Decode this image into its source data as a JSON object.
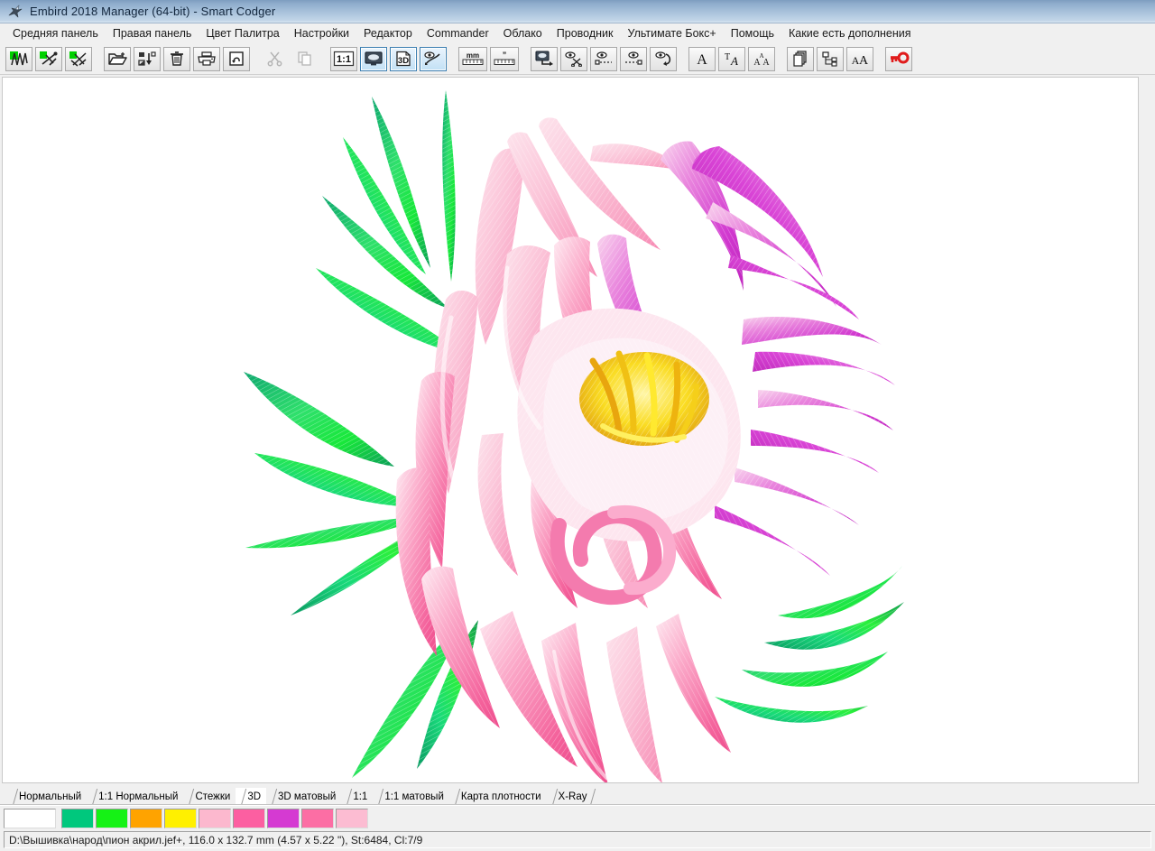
{
  "window": {
    "title": "Embird 2018 Manager (64-bit) - Smart Codger",
    "icon": "bird-icon"
  },
  "menubar": {
    "items": [
      {
        "label": "Средняя панель",
        "name": "menu-middle-panel"
      },
      {
        "label": "Правая панель",
        "name": "menu-right-panel"
      },
      {
        "label": "Цвет Палитра",
        "name": "menu-color-palette"
      },
      {
        "label": "Настройки",
        "name": "menu-settings"
      },
      {
        "label": "Редактор",
        "name": "menu-editor"
      },
      {
        "label": "Commander",
        "name": "menu-commander"
      },
      {
        "label": "Облако",
        "name": "menu-cloud"
      },
      {
        "label": "Проводник",
        "name": "menu-explorer"
      },
      {
        "label": "Ультимате Бокс+",
        "name": "menu-ultimate-box-plus"
      },
      {
        "label": "Помощь",
        "name": "menu-help"
      },
      {
        "label": "Какие есть дополнения",
        "name": "menu-addons"
      }
    ]
  },
  "toolbar": {
    "buttons": [
      {
        "name": "show-stitches-button",
        "icon": "green-zigzag-icon",
        "active": false,
        "group": 0
      },
      {
        "name": "hide-jumps-button",
        "icon": "green-needle-cross-icon",
        "active": false,
        "group": 0
      },
      {
        "name": "hide-trims-button",
        "icon": "green-double-cross-icon",
        "active": false,
        "group": 0
      },
      {
        "name": "open-file-button",
        "icon": "open-folder-icon",
        "active": false,
        "group": 1
      },
      {
        "name": "save-as-button",
        "icon": "save-arrow-icon",
        "active": false,
        "group": 1
      },
      {
        "name": "delete-button",
        "icon": "trash-icon",
        "active": false,
        "group": 1
      },
      {
        "name": "print-button",
        "icon": "printer-icon",
        "active": false,
        "group": 1
      },
      {
        "name": "print-preview-button",
        "icon": "page-preview-icon",
        "active": false,
        "group": 1
      },
      {
        "name": "cut-button",
        "icon": "scissors-icon",
        "active": false,
        "group": 2,
        "disabled": true
      },
      {
        "name": "copy-button",
        "icon": "copy-pages-icon",
        "active": false,
        "group": 2,
        "disabled": true
      },
      {
        "name": "zoom-one-to-one-button",
        "icon": "1-to-1-icon",
        "active": false,
        "group": 3
      },
      {
        "name": "realistic-view-button",
        "icon": "monitor-icon",
        "active": true,
        "group": 3
      },
      {
        "name": "three-d-view-button",
        "icon": "3d-icon",
        "active": true,
        "group": 3
      },
      {
        "name": "needle-view-button",
        "icon": "eye-needle-icon",
        "active": true,
        "group": 3
      },
      {
        "name": "millimeter-ruler-button",
        "icon": "mm-ruler-icon",
        "active": false,
        "group": 4
      },
      {
        "name": "inch-ruler-button",
        "icon": "inch-ruler-icon",
        "active": false,
        "group": 4
      },
      {
        "name": "send-to-machine-button",
        "icon": "monitor-arrow-icon",
        "active": false,
        "group": 5
      },
      {
        "name": "cut-visibility-button",
        "icon": "eye-scissors-icon",
        "active": false,
        "group": 5
      },
      {
        "name": "show-from-start-button",
        "icon": "eye-slider-left-icon",
        "active": false,
        "group": 5
      },
      {
        "name": "show-to-end-button",
        "icon": "eye-slider-right-icon",
        "active": false,
        "group": 5
      },
      {
        "name": "refresh-view-button",
        "icon": "eye-loop-icon",
        "active": false,
        "group": 5
      },
      {
        "name": "lettering-button",
        "icon": "letter-a-icon",
        "active": false,
        "group": 6
      },
      {
        "name": "edit-text-button",
        "icon": "text-edit-icon",
        "active": false,
        "group": 6
      },
      {
        "name": "font-engine-button",
        "icon": "font-pyramid-icon",
        "active": false,
        "group": 6
      },
      {
        "name": "duplicate-button",
        "icon": "stacked-pages-icon",
        "active": false,
        "group": 7
      },
      {
        "name": "hierarchy-button",
        "icon": "tree-nodes-icon",
        "active": false,
        "group": 7
      },
      {
        "name": "compare-fonts-button",
        "icon": "aa-icon",
        "active": false,
        "group": 7
      },
      {
        "name": "license-key-button",
        "icon": "red-key-icon",
        "active": false,
        "group": 8
      }
    ]
  },
  "tabs": {
    "items": [
      {
        "label": "Нормальный",
        "name": "tab-normal",
        "selected": false
      },
      {
        "label": "1:1 Нормальный",
        "name": "tab-1-1-normal",
        "selected": false
      },
      {
        "label": "Стежки",
        "name": "tab-stitches",
        "selected": false
      },
      {
        "label": "3D",
        "name": "tab-3d",
        "selected": true
      },
      {
        "label": "3D матовый",
        "name": "tab-3d-matte",
        "selected": false
      },
      {
        "label": "1:1",
        "name": "tab-1-1",
        "selected": false
      },
      {
        "label": "1:1 матовый",
        "name": "tab-1-1-matte",
        "selected": false
      },
      {
        "label": "Карта плотности",
        "name": "tab-density-map",
        "selected": false
      },
      {
        "label": "X-Ray",
        "name": "tab-x-ray",
        "selected": false
      }
    ]
  },
  "palette": {
    "colors": [
      {
        "hex": "#ffffff",
        "name": "swatch-white"
      },
      {
        "hex": "#00c87d",
        "name": "swatch-emerald-green"
      },
      {
        "hex": "#15f215",
        "name": "swatch-bright-green"
      },
      {
        "hex": "#ffa300",
        "name": "swatch-orange"
      },
      {
        "hex": "#fff000",
        "name": "swatch-yellow"
      },
      {
        "hex": "#fcb8ce",
        "name": "swatch-light-pink"
      },
      {
        "hex": "#fc5fa1",
        "name": "swatch-hot-pink"
      },
      {
        "hex": "#d53ad2",
        "name": "swatch-magenta"
      },
      {
        "hex": "#fc6ea4",
        "name": "swatch-pink"
      },
      {
        "hex": "#fcbcd2",
        "name": "swatch-pale-pink"
      }
    ]
  },
  "statusbar": {
    "text": "D:\\Вышивка\\народ\\пион акрил.jef+, 116.0 x 132.7 mm (4.57 x 5.22 \"), St:6484, Cl:7/9"
  },
  "design": {
    "file_path": "D:\\Вышивка\\народ\\пион акрил.jef+",
    "width_mm": "116.0",
    "height_mm": "132.7",
    "width_in": "4.57",
    "height_in": "5.22",
    "stitches": "6484",
    "colors": "7/9",
    "subject": "pink peony flower with green leaves"
  },
  "theme": {
    "titlebar_start": "#7d9dc0",
    "titlebar_end": "#dce8f2",
    "chrome_bg": "#f0f0f0",
    "canvas_bg": "#ffffff",
    "active_btn_border": "#3c7fb1",
    "accent_red": "#e01b1b"
  }
}
